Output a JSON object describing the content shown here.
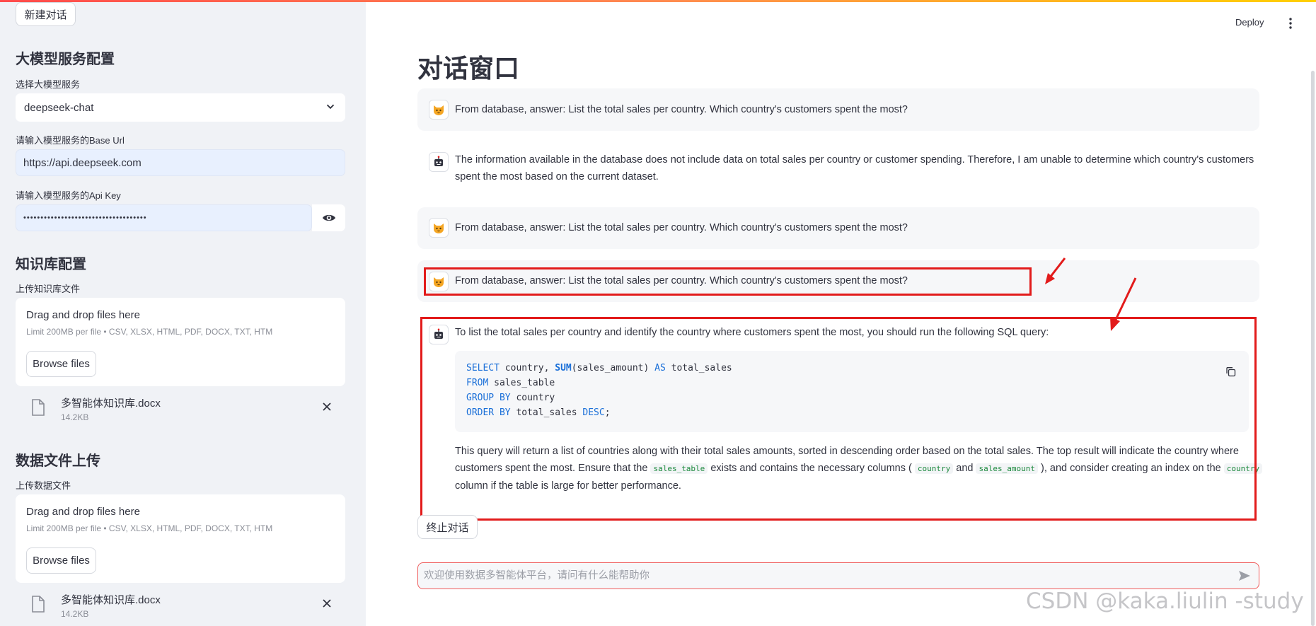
{
  "sidebar": {
    "new_chat_button": "新建对话",
    "llm_section_title": "大模型服务配置",
    "select_service_label": "选择大模型服务",
    "selected_service": "deepseek-chat",
    "base_url_label": "请输入模型服务的Base Url",
    "base_url_value": "https://api.deepseek.com",
    "api_key_label": "请输入模型服务的Api Key",
    "api_key_value": "••••••••••••••••••••••••••••••••••••",
    "kb_section_title": "知识库配置",
    "kb_upload_label": "上传知识库文件",
    "data_section_title": "数据文件上传",
    "data_upload_label": "上传数据文件",
    "dropzone": {
      "title": "Drag and drop files here",
      "limit": "Limit 200MB per file • CSV, XLSX, HTML, PDF, DOCX, TXT, HTM",
      "browse_button": "Browse files"
    },
    "kb_file": {
      "name": "多智能体知识库.docx",
      "size": "14.2KB"
    },
    "data_file": {
      "name": "多智能体知识库.docx",
      "size": "14.2KB"
    }
  },
  "header": {
    "deploy": "Deploy",
    "menu_icon": "kebab-menu-icon"
  },
  "main": {
    "title": "对话窗口",
    "messages": [
      {
        "role": "user",
        "avatar": "cat-icon",
        "text": "From database, answer: List the total sales per country. Which country's customers spent the most?"
      },
      {
        "role": "assistant",
        "avatar": "robot-icon",
        "line1": "The information available in the database does not include data on total sales per country or customer spending. Therefore, I am unable to determine which country's customers",
        "line2": "spent the most based on the current dataset."
      },
      {
        "role": "user",
        "avatar": "cat-icon",
        "text": "From database, answer: List the total sales per country. Which country's customers spent the most?"
      },
      {
        "role": "user",
        "avatar": "cat-icon",
        "text": "From database, answer: List the total sales per country. Which country's customers spent the most?"
      },
      {
        "role": "assistant",
        "avatar": "robot-icon",
        "intro": "To list the total sales per country and identify the country where customers spent the most, you should run the following SQL query:",
        "code": {
          "l1_kw1": "SELECT",
          "l1_a": " country, ",
          "l1_fn": "SUM",
          "l1_b": "(sales_amount) ",
          "l1_kw2": "AS",
          "l1_c": " total_sales",
          "l2_kw": "FROM",
          "l2_a": " sales_table",
          "l3_kw": "GROUP BY",
          "l3_a": " country",
          "l4_kw1": "ORDER BY",
          "l4_a": " total_sales ",
          "l4_kw2": "DESC",
          "l4_b": ";"
        },
        "p_line1": "This query will return a list of countries along with their total sales amounts, sorted in descending order based on the total sales. The top result will indicate the country where",
        "p_line2_a": "customers spent the most. Ensure that the ",
        "p_code_table": "sales_table",
        "p_line2_b": " exists and contains the necessary columns ( ",
        "p_code_country": "country",
        "p_line2_c": " and ",
        "p_code_amount": "sales_amount",
        "p_line2_d": " ), and consider creating an index on the ",
        "p_code_country2": "country",
        "p_line3": "column if the table is large for better performance."
      }
    ],
    "stop_button": "终止对话",
    "chat_placeholder": "欢迎使用数据多智能体平台，请问有什么能帮助你"
  },
  "watermark": "CSDN @kaka.liulin -study",
  "colors": {
    "annotation_red": "#e21b1b",
    "accent": "#ff4b4b",
    "keyword_blue": "#1a6fd8",
    "inline_code_green": "#1d8a3e"
  }
}
